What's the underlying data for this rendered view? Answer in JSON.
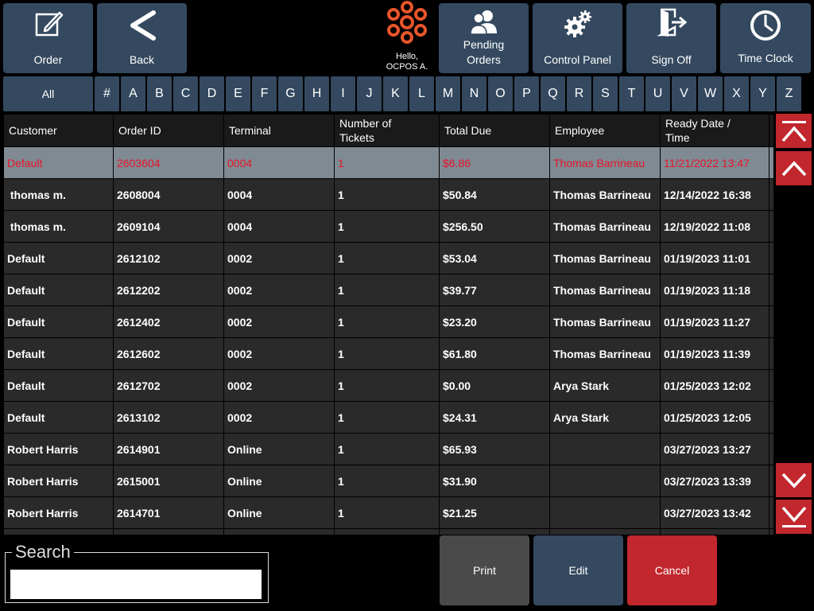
{
  "toolbar": {
    "order": {
      "label": "Order",
      "icon": "edit-icon"
    },
    "back": {
      "label": "Back",
      "icon": "chevron-left-icon"
    },
    "pending": {
      "label": "Pending Orders",
      "icon": "users-icon"
    },
    "control": {
      "label": "Control Panel",
      "icon": "gears-icon"
    },
    "signoff": {
      "label": "Sign Off",
      "icon": "exit-door-icon"
    },
    "timeclock": {
      "label": "Time Clock",
      "icon": "clock-icon"
    }
  },
  "logo": {
    "greeting": "Hello,",
    "user": "OCPOS A.",
    "color": "#e8552a"
  },
  "alphabet": [
    "All",
    "#",
    "A",
    "B",
    "C",
    "D",
    "E",
    "F",
    "G",
    "H",
    "I",
    "J",
    "K",
    "L",
    "M",
    "N",
    "O",
    "P",
    "Q",
    "R",
    "S",
    "T",
    "U",
    "V",
    "W",
    "X",
    "Y",
    "Z"
  ],
  "table": {
    "headers": [
      "Customer",
      "Order ID",
      "Terminal",
      "Number of Tickets",
      "Total Due",
      "Employee",
      "Ready Date / Time"
    ],
    "rows": [
      [
        "Default",
        "2603604",
        "0004",
        "1",
        "$6.86",
        "Thomas Barrineau",
        "11/21/2022 13:47"
      ],
      [
        " thomas m.",
        "2608004",
        "0004",
        "1",
        "$50.84",
        "Thomas Barrineau",
        "12/14/2022 16:38"
      ],
      [
        " thomas m.",
        "2609104",
        "0004",
        "1",
        "$256.50",
        "Thomas Barrineau",
        "12/19/2022 11:08"
      ],
      [
        "Default",
        "2612102",
        "0002",
        "1",
        "$53.04",
        "Thomas Barrineau",
        "01/19/2023 11:01"
      ],
      [
        "Default",
        "2612202",
        "0002",
        "1",
        "$39.77",
        "Thomas Barrineau",
        "01/19/2023 11:18"
      ],
      [
        "Default",
        "2612402",
        "0002",
        "1",
        "$23.20",
        "Thomas Barrineau",
        "01/19/2023 11:27"
      ],
      [
        "Default",
        "2612602",
        "0002",
        "1",
        "$61.80",
        "Thomas Barrineau",
        "01/19/2023 11:39"
      ],
      [
        "Default",
        "2612702",
        "0002",
        "1",
        "$0.00",
        "Arya Stark",
        "01/25/2023 12:02"
      ],
      [
        "Default",
        "2613102",
        "0002",
        "1",
        "$24.31",
        "Arya Stark",
        "01/25/2023 12:05"
      ],
      [
        "Robert Harris",
        "2614901",
        "Online",
        "1",
        "$65.93",
        "",
        "03/27/2023 13:27"
      ],
      [
        "Robert Harris",
        "2615001",
        "Online",
        "1",
        "$31.90",
        "",
        "03/27/2023 13:39"
      ],
      [
        "Robert Harris",
        "2614701",
        "Online",
        "1",
        "$21.25",
        "",
        "03/27/2023 13:42"
      ],
      [
        "",
        "",
        "",
        "",
        "",
        "",
        ""
      ]
    ],
    "selected_index": 0
  },
  "search": {
    "legend": "Search",
    "value": "",
    "placeholder": ""
  },
  "actions": {
    "print": "Print",
    "edit": "Edit",
    "cancel": "Cancel"
  },
  "colors": {
    "button": "#34495f",
    "danger": "#c1272d",
    "print": "#4a4a4a",
    "selected_row": "#808a92",
    "selected_text": "#e8142c"
  }
}
